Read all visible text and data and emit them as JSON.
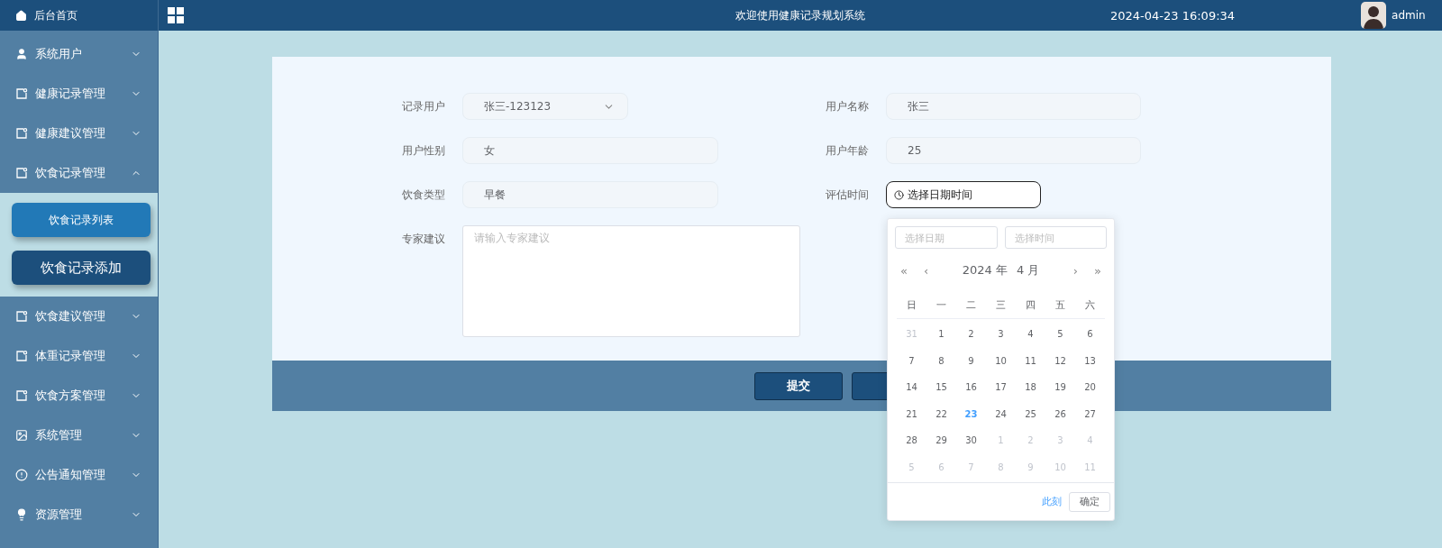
{
  "header": {
    "home": "后台首页",
    "title": "欢迎使用健康记录规划系统",
    "datetime": "2024-04-23 16:09:34",
    "user": "admin"
  },
  "sidebar": {
    "items": [
      {
        "kind": "user",
        "label": "系统用户",
        "expanded": false
      },
      {
        "kind": "doc",
        "label": "健康记录管理",
        "expanded": false
      },
      {
        "kind": "doc",
        "label": "健康建议管理",
        "expanded": false
      },
      {
        "kind": "doc",
        "label": "饮食记录管理",
        "expanded": true,
        "children": [
          {
            "label": "饮食记录列表",
            "selected": false
          },
          {
            "label": "饮食记录添加",
            "selected": true
          }
        ]
      },
      {
        "kind": "doc",
        "label": "饮食建议管理",
        "expanded": false
      },
      {
        "kind": "doc",
        "label": "体重记录管理",
        "expanded": false
      },
      {
        "kind": "doc",
        "label": "饮食方案管理",
        "expanded": false
      },
      {
        "kind": "image",
        "label": "系统管理",
        "expanded": false
      },
      {
        "kind": "info",
        "label": "公告通知管理",
        "expanded": false
      },
      {
        "kind": "bulb",
        "label": "资源管理",
        "expanded": false
      }
    ]
  },
  "form": {
    "fields": [
      {
        "kind": "select",
        "label": "记录用户",
        "value": "张三-123123"
      },
      {
        "kind": "text",
        "label": "用户名称",
        "value": "张三"
      },
      {
        "kind": "text",
        "label": "用户性别",
        "value": "女"
      },
      {
        "kind": "text",
        "label": "用户年龄",
        "value": "25"
      },
      {
        "kind": "text",
        "label": "饮食类型",
        "value": "早餐"
      },
      {
        "kind": "datetime",
        "label": "评估时间",
        "placeholder": "选择日期时间"
      },
      {
        "kind": "textarea",
        "label": "专家建议",
        "placeholder": "请输入专家建议"
      }
    ],
    "buttons": [
      {
        "kind": "submit",
        "label": "提交"
      },
      {
        "kind": "hidden"
      }
    ]
  },
  "date_picker": {
    "date_placeholder": "选择日期",
    "time_placeholder": "选择时间",
    "prev_year": "«",
    "prev_month": "‹",
    "year": "2024 年",
    "month": "4 月",
    "next_month": "›",
    "next_year": "»",
    "weekdays": [
      "日",
      "一",
      "二",
      "三",
      "四",
      "五",
      "六"
    ],
    "days": [
      {
        "label": "31",
        "muted": true,
        "today": false
      },
      {
        "label": "1",
        "muted": false,
        "today": false
      },
      {
        "label": "2",
        "muted": false,
        "today": false
      },
      {
        "label": "3",
        "muted": false,
        "today": false
      },
      {
        "label": "4",
        "muted": false,
        "today": false
      },
      {
        "label": "5",
        "muted": false,
        "today": false
      },
      {
        "label": "6",
        "muted": false,
        "today": false
      },
      {
        "label": "7",
        "muted": false,
        "today": false
      },
      {
        "label": "8",
        "muted": false,
        "today": false
      },
      {
        "label": "9",
        "muted": false,
        "today": false
      },
      {
        "label": "10",
        "muted": false,
        "today": false
      },
      {
        "label": "11",
        "muted": false,
        "today": false
      },
      {
        "label": "12",
        "muted": false,
        "today": false
      },
      {
        "label": "13",
        "muted": false,
        "today": false
      },
      {
        "label": "14",
        "muted": false,
        "today": false
      },
      {
        "label": "15",
        "muted": false,
        "today": false
      },
      {
        "label": "16",
        "muted": false,
        "today": false
      },
      {
        "label": "17",
        "muted": false,
        "today": false
      },
      {
        "label": "18",
        "muted": false,
        "today": false
      },
      {
        "label": "19",
        "muted": false,
        "today": false
      },
      {
        "label": "20",
        "muted": false,
        "today": false
      },
      {
        "label": "21",
        "muted": false,
        "today": false
      },
      {
        "label": "22",
        "muted": false,
        "today": false
      },
      {
        "label": "23",
        "muted": false,
        "today": true
      },
      {
        "label": "24",
        "muted": false,
        "today": false
      },
      {
        "label": "25",
        "muted": false,
        "today": false
      },
      {
        "label": "26",
        "muted": false,
        "today": false
      },
      {
        "label": "27",
        "muted": false,
        "today": false
      },
      {
        "label": "28",
        "muted": false,
        "today": false
      },
      {
        "label": "29",
        "muted": false,
        "today": false
      },
      {
        "label": "30",
        "muted": false,
        "today": false
      },
      {
        "label": "1",
        "muted": true,
        "today": false
      },
      {
        "label": "2",
        "muted": true,
        "today": false
      },
      {
        "label": "3",
        "muted": true,
        "today": false
      },
      {
        "label": "4",
        "muted": true,
        "today": false
      },
      {
        "label": "5",
        "muted": true,
        "today": false
      },
      {
        "label": "6",
        "muted": true,
        "today": false
      },
      {
        "label": "7",
        "muted": true,
        "today": false
      },
      {
        "label": "8",
        "muted": true,
        "today": false
      },
      {
        "label": "9",
        "muted": true,
        "today": false
      },
      {
        "label": "10",
        "muted": true,
        "today": false
      },
      {
        "label": "11",
        "muted": true,
        "today": false
      }
    ],
    "now": "此刻",
    "confirm": "确定"
  }
}
